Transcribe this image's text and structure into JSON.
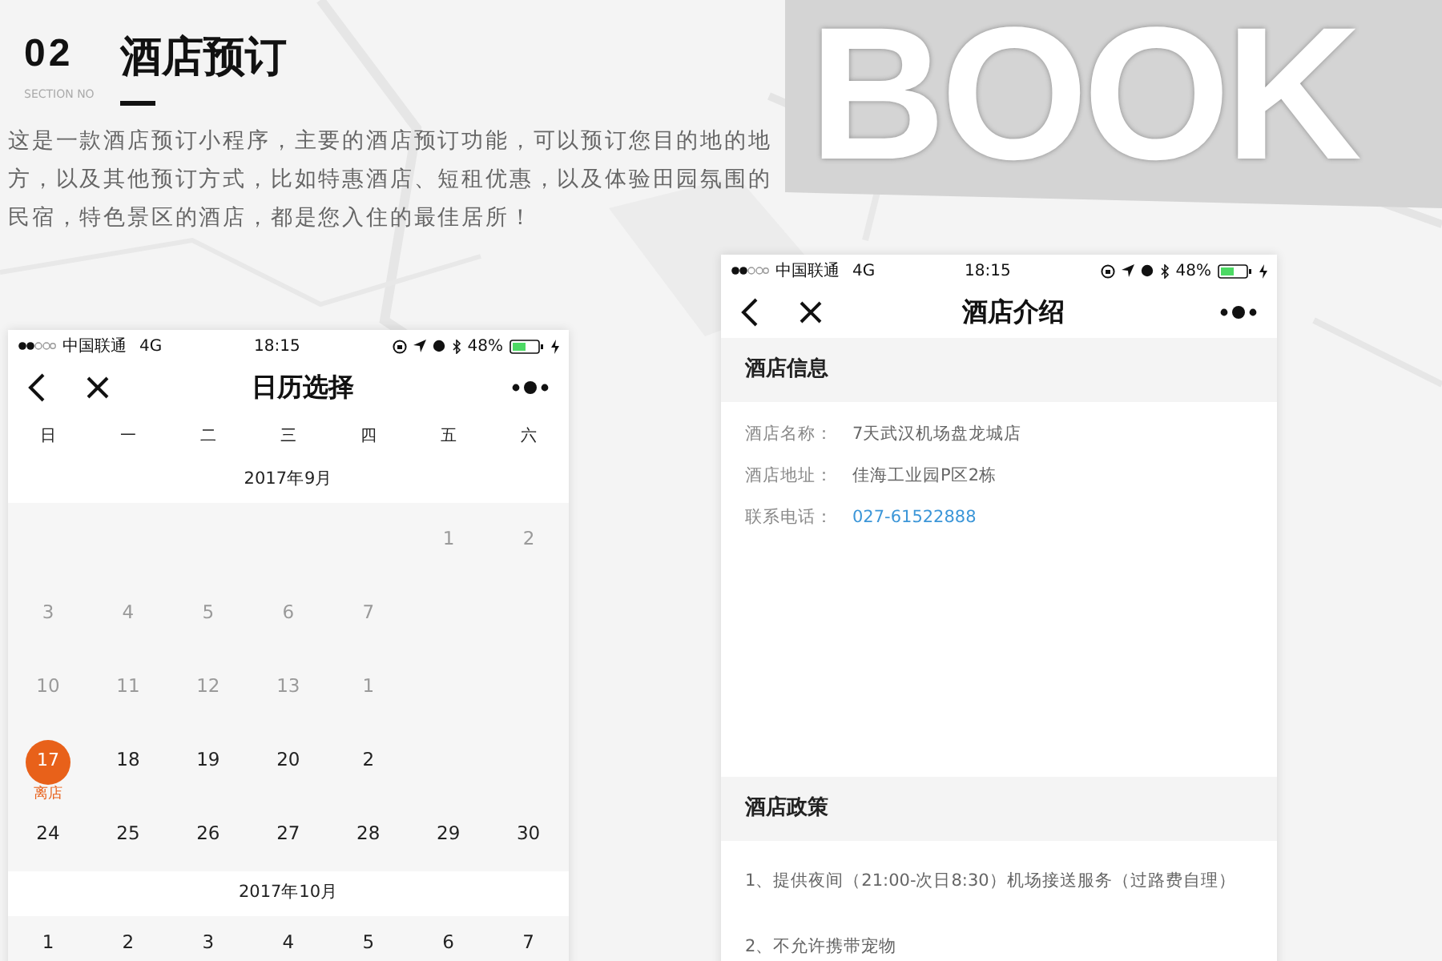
{
  "header": {
    "number": "02",
    "section_label": "SECTION NO",
    "title": "酒店预订",
    "description": "这是一款酒店预订小程序，主要的酒店预订功能，可以预订您目的地的地方，以及其他预订方式，比如特惠酒店、短租优惠，以及体验田园氛围的民宿，特色景区的酒店，都是您入住的最佳居所！"
  },
  "backdrop": {
    "word": "BOOK"
  },
  "phones": [
    {
      "kind": "calendar",
      "status_bar": {
        "carrier": "中国联通",
        "network": "4G",
        "time": "18:15",
        "battery": "48%"
      },
      "nav_title": "日历选择",
      "weekdays": [
        "日",
        "一",
        "二",
        "三",
        "四",
        "五",
        "六"
      ],
      "months": [
        {
          "label": "2017年9月",
          "weeks": [
            {
              "kind": "trailing",
              "days": [
                {
                  "text": "1",
                  "past": true,
                  "selected": false
                },
                {
                  "text": "2",
                  "past": true,
                  "selected": false
                }
              ]
            },
            {
              "kind": "leading",
              "days": [
                {
                  "text": "3",
                  "past": true,
                  "selected": false
                },
                {
                  "text": "4",
                  "past": true,
                  "selected": false
                },
                {
                  "text": "5",
                  "past": true,
                  "selected": false
                },
                {
                  "text": "6",
                  "past": true,
                  "selected": false
                },
                {
                  "text": "7",
                  "past": true,
                  "selected": false
                }
              ]
            },
            {
              "kind": "leading",
              "days": [
                {
                  "text": "10",
                  "past": true,
                  "selected": false
                },
                {
                  "text": "11",
                  "past": true,
                  "selected": false
                },
                {
                  "text": "12",
                  "past": true,
                  "selected": false
                },
                {
                  "text": "13",
                  "past": true,
                  "selected": false
                },
                {
                  "text": "1",
                  "past": true,
                  "selected": false
                }
              ]
            },
            {
              "kind": "leading",
              "days": [
                {
                  "text": "17",
                  "past": false,
                  "selected": true,
                  "note": "离店"
                },
                {
                  "text": "18",
                  "past": false,
                  "selected": false
                },
                {
                  "text": "19",
                  "past": false,
                  "selected": false
                },
                {
                  "text": "20",
                  "past": false,
                  "selected": false
                },
                {
                  "text": "2",
                  "past": false,
                  "selected": false
                }
              ]
            },
            {
              "kind": "leading",
              "days": [
                {
                  "text": "24",
                  "past": false,
                  "selected": false
                },
                {
                  "text": "25",
                  "past": false,
                  "selected": false
                },
                {
                  "text": "26",
                  "past": false,
                  "selected": false
                },
                {
                  "text": "27",
                  "past": false,
                  "selected": false
                },
                {
                  "text": "28",
                  "past": false,
                  "selected": false
                },
                {
                  "text": "29",
                  "past": false,
                  "selected": false
                },
                {
                  "text": "30",
                  "past": false,
                  "selected": false
                }
              ]
            }
          ]
        },
        {
          "label": "2017年10月",
          "weeks": [
            {
              "kind": "leading",
              "days": [
                {
                  "text": "1",
                  "past": false,
                  "selected": false
                },
                {
                  "text": "2",
                  "past": false,
                  "selected": false
                },
                {
                  "text": "3",
                  "past": false,
                  "selected": false
                },
                {
                  "text": "4",
                  "past": false,
                  "selected": false
                },
                {
                  "text": "5",
                  "past": false,
                  "selected": false
                },
                {
                  "text": "6",
                  "past": false,
                  "selected": false
                },
                {
                  "text": "7",
                  "past": false,
                  "selected": false
                }
              ]
            }
          ]
        }
      ]
    },
    {
      "kind": "hotel_info",
      "status_bar": {
        "carrier": "中国联通",
        "network": "4G",
        "time": "18:15",
        "battery": "48%"
      },
      "nav_title": "酒店介绍",
      "sections": [
        {
          "title": "酒店信息",
          "rows": [
            {
              "label": "酒店名称：",
              "value": "7天武汉机场盘龙城店",
              "kind": "text"
            },
            {
              "label": "酒店地址：",
              "value": "佳海工业园P区2栋",
              "kind": "text"
            },
            {
              "label": "联系电话：",
              "value": "027-61522888",
              "kind": "phone"
            }
          ]
        },
        {
          "title": "酒店政策",
          "items": [
            "1、提供夜间（21:00-次日8:30）机场接送服务（过路费自理）",
            "2、不允许携带宠物"
          ]
        }
      ]
    }
  ]
}
